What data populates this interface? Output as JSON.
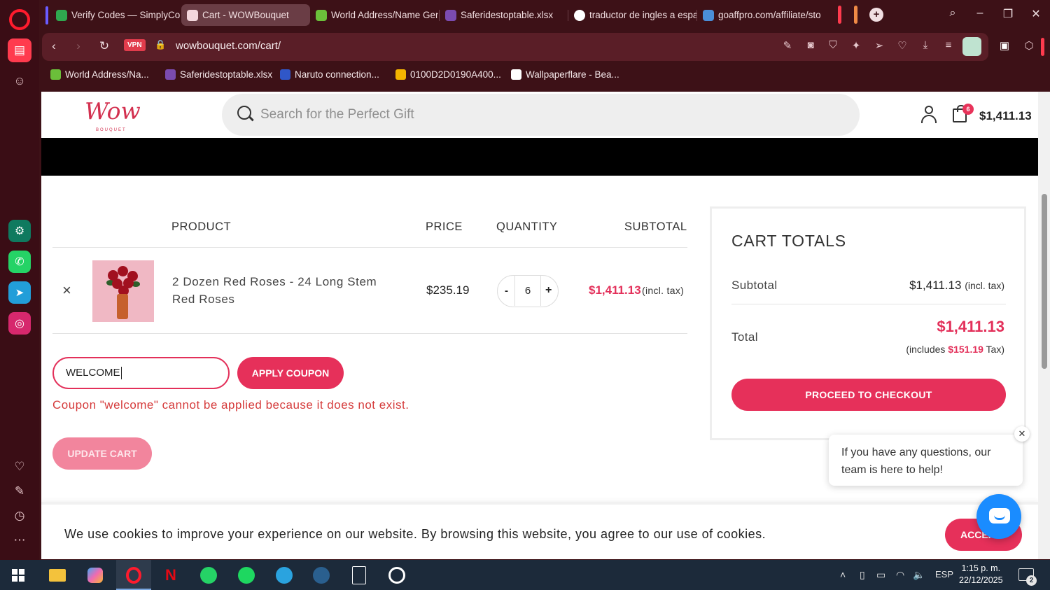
{
  "browser": {
    "tabs": [
      {
        "label": "Verify Codes — SimplyCo",
        "favicon_color": "#2fa84f"
      },
      {
        "label": "Cart - WOWBouquet",
        "favicon_color": "#f3d6dc"
      },
      {
        "label": "World Address/Name Gen",
        "favicon_color": "#6bbf3a"
      },
      {
        "label": "Saferidestoptable.xlsx",
        "favicon_color": "#7b4bb0"
      },
      {
        "label": "traductor de ingles a espa",
        "favicon_color": "#ffffff"
      },
      {
        "label": "goaffpro.com/affiliate/sto",
        "favicon_color": "#4a8ed8"
      }
    ],
    "vpn_label": "VPN",
    "url": "wowbouquet.com/cart/",
    "bookmarks": [
      {
        "label": "World Address/Na...",
        "icon_color": "#6bbf3a"
      },
      {
        "label": "Saferidestoptable.xlsx",
        "icon_color": "#7b4bb0"
      },
      {
        "label": "Naruto connection...",
        "icon_color": "#3057c8"
      },
      {
        "label": "0100D2D0190A400...",
        "icon_color": "#f4b400"
      },
      {
        "label": "Wallpaperflare - Bea...",
        "icon_color": "#ffffff"
      }
    ]
  },
  "site": {
    "logo_text": "Wow",
    "logo_sub": "BOUQUET",
    "search_placeholder": "Search for the Perfect Gift",
    "cart_count": "6",
    "header_total": "$1,411.13"
  },
  "cart": {
    "headers": {
      "product": "PRODUCT",
      "price": "PRICE",
      "quantity": "QUANTITY",
      "subtotal": "SUBTOTAL"
    },
    "item": {
      "remove_icon": "×",
      "name": "2 Dozen Red Roses - 24 Long Stem Red Roses",
      "price": "$235.19",
      "quantity": "6",
      "minus": "-",
      "plus": "+",
      "subtotal": "$1,411.13",
      "subtotal_note": "(incl. tax)"
    },
    "coupon_value": "WELCOME",
    "apply_label": "APPLY COUPON",
    "coupon_error": "Coupon \"welcome\" cannot be applied because it does not exist.",
    "update_label": "UPDATE CART"
  },
  "totals": {
    "title": "CART TOTALS",
    "subtotal_label": "Subtotal",
    "subtotal_value": "$1,411.13",
    "subtotal_tax_note": "(incl. tax)",
    "total_label": "Total",
    "total_value": "$1,411.13",
    "includes_prefix": "(includes",
    "tax_amount": "$151.19",
    "includes_suffix": "Tax)",
    "checkout_label": "PROCEED TO CHECKOUT"
  },
  "chat": {
    "bubble_text": "If you have any questions, our team is here to help!",
    "close_icon": "✕"
  },
  "cookie": {
    "text": "We use cookies to improve your experience on our website. By browsing this website, you agree to our use of cookies.",
    "accept_label": "ACCEPT"
  },
  "taskbar": {
    "language": "ESP",
    "time": "1:15 p. m.",
    "date": "22/12/2025",
    "notification_count": "2"
  },
  "colors": {
    "accent": "#e6305a",
    "browser_bg": "#3d1117",
    "error": "#d53b3b"
  }
}
